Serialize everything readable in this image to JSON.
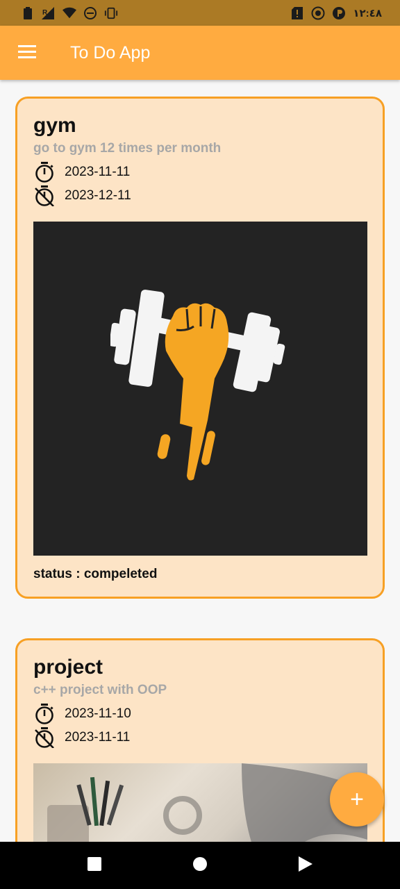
{
  "status_bar": {
    "time": "١٢:٤٨",
    "icons_left": [
      "battery-icon",
      "signal-r-icon",
      "wifi-icon",
      "dnd-icon",
      "vibrate-icon"
    ],
    "icons_right": [
      "sim-alert-icon",
      "record-icon",
      "data-saver-icon"
    ]
  },
  "app_bar": {
    "title": "To Do App",
    "menu_icon": "menu-icon",
    "background": "#ffab40"
  },
  "tasks": [
    {
      "title": "gym",
      "description": "go to gym 12 times per month",
      "start_date": "2023-11-11",
      "end_date": "2023-12-11",
      "status": "status : compeleted",
      "image": "gym-dumbbell-fist"
    },
    {
      "title": "project",
      "description": "c++ project with OOP",
      "start_date": "2023-11-10",
      "end_date": "2023-11-11",
      "image": "desk-photo"
    }
  ],
  "fab": {
    "label": "+",
    "icon": "add-icon"
  },
  "nav_bar": {
    "buttons": [
      "recents-button",
      "home-button",
      "back-button"
    ]
  },
  "colors": {
    "card_bg": "#fde4c6",
    "card_border": "#f7a024",
    "accent": "#ffab40",
    "status_bar": "#ab7a25"
  }
}
